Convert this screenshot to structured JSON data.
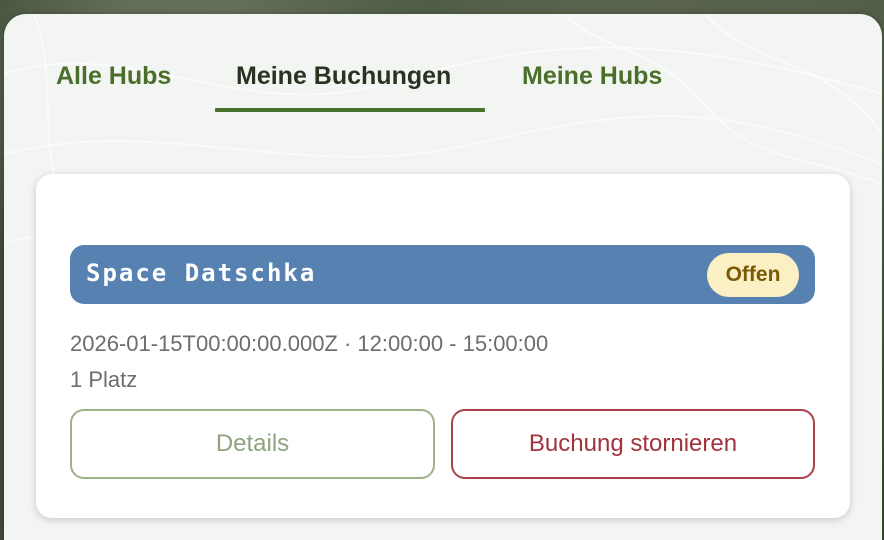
{
  "tabs": [
    {
      "label": "Alle Hubs",
      "active": false
    },
    {
      "label": "Meine Buchungen",
      "active": true
    },
    {
      "label": "Meine Hubs",
      "active": false
    }
  ],
  "booking": {
    "hub_name": "Space Datschka",
    "status": "Offen",
    "datetime": "2026-01-15T00:00:00.000Z · 12:00:00 - 15:00:00",
    "seats": "1 Platz",
    "details_label": "Details",
    "cancel_label": "Buchung stornieren"
  },
  "colors": {
    "accent": "#47702a",
    "banner": "#5681b1",
    "badge_bg": "#fbefc4",
    "cancel": "#a0333c"
  }
}
